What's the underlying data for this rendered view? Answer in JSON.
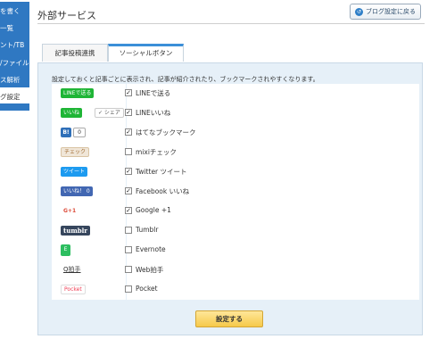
{
  "sidebar": {
    "items": [
      {
        "label": "を書く"
      },
      {
        "label": "一覧"
      },
      {
        "label": "ント/TB"
      },
      {
        "label": "/ファイル"
      },
      {
        "label": "ス解析"
      },
      {
        "label": "グ設定"
      }
    ]
  },
  "header": {
    "title": "外部サービス",
    "back_button": "ブログ設定に戻る"
  },
  "tabs": [
    {
      "label": "記事投稿連携"
    },
    {
      "label": "ソーシャルボタン"
    }
  ],
  "panel": {
    "intro": "設定しておくと記事ごとに表示され、記事が紹介されたり、ブックマークされやすくなります。",
    "rows": [
      {
        "badge": "LINEで送る",
        "badge2": "",
        "checked": "✓",
        "label": "LINEで送る",
        "icon": "line-send-icon"
      },
      {
        "badge": "いいね",
        "badge2": "✓ シェア",
        "checked": "✓",
        "label": "LINEいいね",
        "icon": "line-like-icon"
      },
      {
        "badge": "B!",
        "badge2": "0",
        "checked": "✓",
        "label": "はてなブックマーク",
        "icon": "hatena-bookmark-icon"
      },
      {
        "badge": "チェック",
        "badge2": "",
        "checked": "",
        "label": "mixiチェック",
        "icon": "mixi-check-icon"
      },
      {
        "badge": "ツイート",
        "badge2": "",
        "checked": "✓",
        "label": "Twitter ツイート",
        "icon": "twitter-tweet-icon"
      },
      {
        "badge": "いいね！ 0",
        "badge2": "",
        "checked": "✓",
        "label": "Facebook いいね",
        "icon": "facebook-like-icon"
      },
      {
        "badge": "G+1",
        "badge2": "",
        "checked": "✓",
        "label": "Google +1",
        "icon": "google-plus-icon"
      },
      {
        "badge": "tumblr",
        "badge2": "",
        "checked": "",
        "label": "Tumblr",
        "icon": "tumblr-icon"
      },
      {
        "badge": "E",
        "badge2": "",
        "checked": "",
        "label": "Evernote",
        "icon": "evernote-icon"
      },
      {
        "badge": "Q拍手",
        "badge2": "",
        "checked": "",
        "label": "Web拍手",
        "icon": "web-clap-icon"
      },
      {
        "badge": "Pocket",
        "badge2": "",
        "checked": "",
        "label": "Pocket",
        "icon": "pocket-icon"
      }
    ]
  },
  "submit_label": "設定する"
}
